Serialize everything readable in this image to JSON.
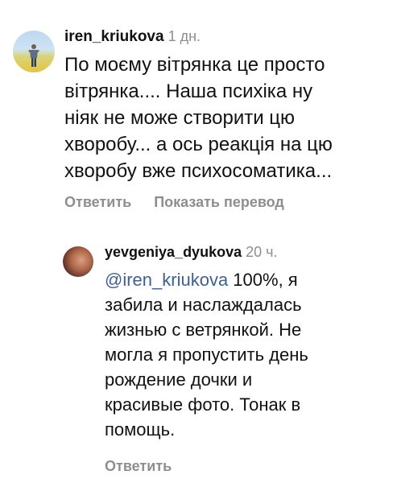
{
  "comments": [
    {
      "username": "iren_kriukova",
      "time": "1 дн.",
      "text": "По моєму вітрянка це просто\nвітрянка.... Наша психіка ну\nніяк не може створити цю\nхворобу... а ось реакція на цю\nхворобу вже психосоматика...",
      "actions": {
        "reply": "Ответить",
        "translate": "Показать перевод"
      },
      "avatar_icon": "person-in-field-avatar"
    },
    {
      "username": "yevgeniya_dyukova",
      "time": "20 ч.",
      "mention": "@iren_kriukova",
      "text": " 100%, я\nзабила и наслаждалась\nжизнью с ветрянкой. Не\nмогла я пропустить день\nрождение дочки и\nкрасивые фото. Тонак в\nпомощь.",
      "actions": {
        "reply": "Ответить"
      },
      "avatar_icon": "portrait-avatar"
    }
  ],
  "colors": {
    "text": "#111111",
    "secondary": "#8e8e8e",
    "mention": "#3d5f93",
    "background": "#ffffff"
  }
}
